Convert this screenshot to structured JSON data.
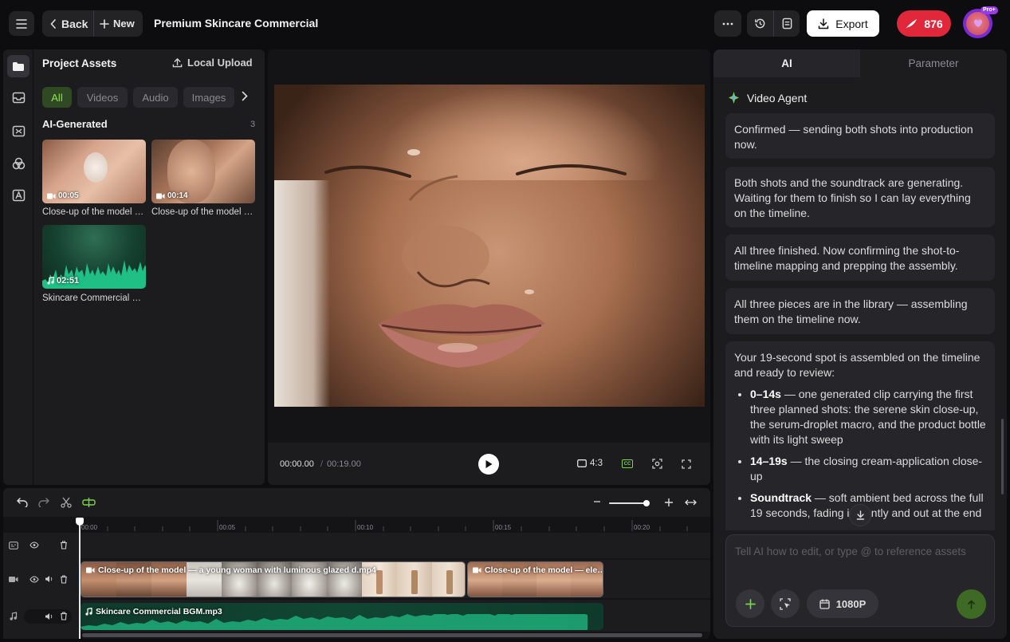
{
  "header": {
    "back_label": "Back",
    "new_label": "New",
    "project_title": "Premium Skincare Commercial",
    "export_label": "Export",
    "credits": "876",
    "pro_badge": "Pro+"
  },
  "assets": {
    "title": "Project Assets",
    "upload_label": "Local Upload",
    "filters": [
      "All",
      "Videos",
      "Audio",
      "Images"
    ],
    "section_title": "AI-Generated",
    "section_count": "3",
    "items": [
      {
        "duration": "00:05",
        "caption": "Close-up of the model — a young woman with luminous glazed d.mp4",
        "kind": "video"
      },
      {
        "duration": "00:14",
        "caption": "Close-up of the model — ele…",
        "kind": "video"
      },
      {
        "duration": "02:51",
        "caption": "Skincare Commercial BGM.mp3",
        "kind": "audio"
      }
    ]
  },
  "player": {
    "current_time": "00:00.00",
    "separator": "/",
    "total_time": "00:19.00",
    "aspect": "4:3",
    "cc_label": "CC"
  },
  "ai_panel": {
    "tabs": [
      "AI",
      "Parameter"
    ],
    "agent_name": "Video Agent",
    "messages": [
      "Confirmed — sending both shots into production now.",
      "Both shots and the soundtrack are generating. Waiting for them to finish so I can lay everything on the timeline.",
      "All three finished. Now confirming the shot-to-timeline mapping and prepping the assembly.",
      "All three pieces are in the library — assembling them on the timeline now."
    ],
    "summary": {
      "intro": "Your 19-second spot is assembled on the timeline and ready to review:",
      "bullets": [
        {
          "bold": "0–14s",
          "text": " — one generated clip carrying the first three planned shots: the serene skin close-up, the serum-droplet macro, and the product bottle with its light sweep"
        },
        {
          "bold": "14–19s",
          "text": " — the closing cream-application close-up"
        },
        {
          "bold": "Soundtrack",
          "text": " — soft ambient bed across the full 19 seconds, fading in gently and out at the end"
        }
      ]
    },
    "input_placeholder": "Tell AI how to edit, or type @ to reference assets",
    "resolution_label": "1080P"
  },
  "timeline": {
    "ruler": [
      "00:00",
      "00:05",
      "00:10",
      "00:15",
      "00:20"
    ],
    "zoom_level": 0.88,
    "clips": [
      {
        "label": "Close-up of the model — a young woman with luminous glazed d.mp4"
      },
      {
        "label": "Close-up of the model — ele…"
      }
    ],
    "audio_clip": "Skincare Commercial BGM.mp3"
  },
  "colors": {
    "accent_green": "#7bd34a",
    "credits_red": "#e0283a",
    "background": "#0d0d0f",
    "panel": "#1c1c1f"
  }
}
